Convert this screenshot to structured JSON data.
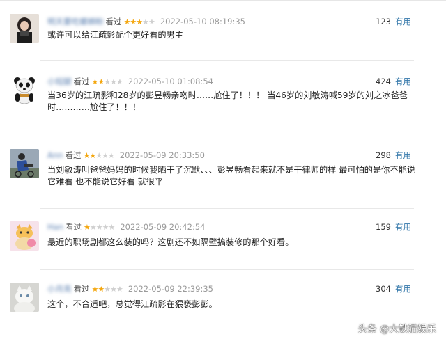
{
  "comments": [
    {
      "user": "明天要吃螺蛳粉",
      "status": "看过",
      "rating": 3,
      "time": "2022-05-10 08:19:35",
      "votes": "123",
      "useful": "有用",
      "text": "或许可以给江疏影配个更好看的男主"
    },
    {
      "user": "小短腿",
      "status": "看过",
      "rating": 2,
      "time": "2022-05-10 01:08:54",
      "votes": "424",
      "useful": "有用",
      "text": "当36岁的江疏影和28岁的彭昱畅亲吻时……尬住了！！！ 当46岁的刘敏涛喊59岁的刘之冰爸爸时…………尬住了！！！"
    },
    {
      "user": "Ann",
      "status": "看过",
      "rating": 2,
      "time": "2022-05-09 20:33:50",
      "votes": "298",
      "useful": "有用",
      "text": "当刘敏涛叫爸爸妈妈的时候我晒干了沉默、、、彭昱畅看起来就不是干律师的样 最可怕的是你不能说它难看 也不能说它好看 就很平"
    },
    {
      "user": "Han",
      "status": "看过",
      "rating": 1,
      "time": "2022-05-09 20:42:54",
      "votes": "159",
      "useful": "有用",
      "text": "最近的职场剧都这么装的吗？这剧还不如隔壁搞装修的那个好看。"
    },
    {
      "user": "小月亮",
      "status": "看过",
      "rating": 2,
      "time": "2022-05-09 22:39:35",
      "votes": "304",
      "useful": "有用",
      "text": "这个，不合适吧，总觉得江疏影在猥亵彭彭。"
    }
  ],
  "watermark": "头条 @大铁猫娱乐",
  "colors": {
    "star": "#f4a70f",
    "link": "#3377aa"
  }
}
